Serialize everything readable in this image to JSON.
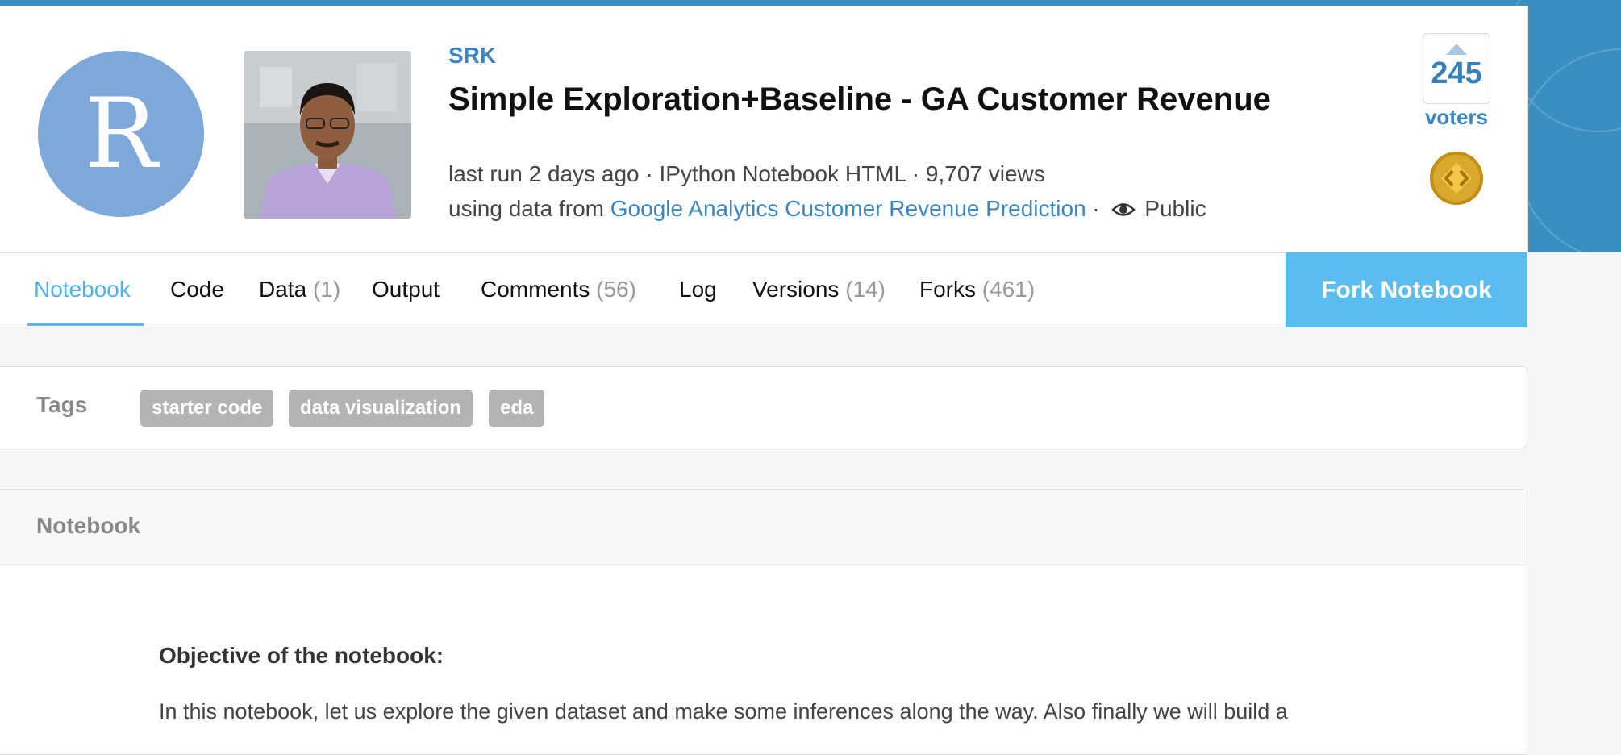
{
  "header": {
    "avatar_letter": "R",
    "author": "SRK",
    "title": "Simple Exploration+Baseline - GA Customer Revenue",
    "meta_line1": "last run 2 days ago · IPython Notebook HTML · 9,707 views",
    "meta_using_prefix": "using data from",
    "dataset_link": "Google Analytics Customer Revenue Prediction",
    "meta_sep": "·",
    "visibility": "Public",
    "vote_count": "245",
    "voters_label": "voters"
  },
  "tabs": [
    {
      "label": "Notebook",
      "count": "",
      "active": true
    },
    {
      "label": "Code",
      "count": ""
    },
    {
      "label": "Data",
      "count": "(1)"
    },
    {
      "label": "Output",
      "count": ""
    },
    {
      "label": "Comments",
      "count": "(56)"
    },
    {
      "label": "Log",
      "count": ""
    },
    {
      "label": "Versions",
      "count": "(14)"
    },
    {
      "label": "Forks",
      "count": "(461)"
    }
  ],
  "fork_button": "Fork Notebook",
  "tags": {
    "label": "Tags",
    "items": [
      "starter code",
      "data visualization",
      "eda"
    ]
  },
  "notebook": {
    "header": "Notebook",
    "objective_heading": "Objective of the notebook:",
    "paragraph": "In this notebook, let us explore the given dataset and make some inferences along the way. Also finally we will build a"
  },
  "icons": {
    "eye": "eye-icon",
    "medal": "medal-icon",
    "upvote": "upvote-arrow-icon"
  },
  "colors": {
    "accent": "#3b86c1",
    "tab_active": "#4ab3ea",
    "fork_button": "#5bbcf0",
    "banner": "#3a8fc2",
    "tag_bg": "#b3b3b3"
  }
}
